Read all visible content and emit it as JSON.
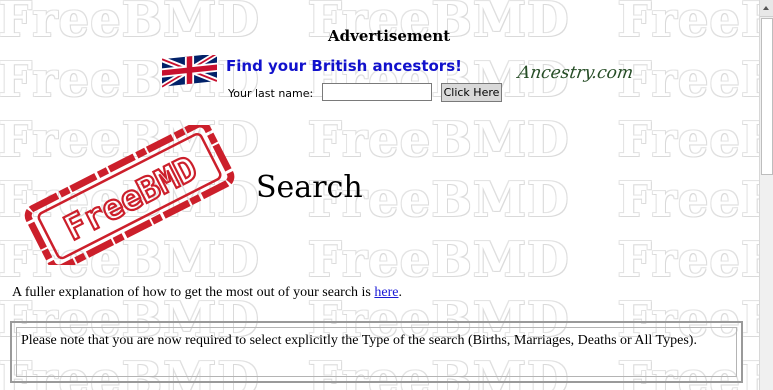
{
  "watermark": "FreeBMD",
  "ad": {
    "title": "Advertisement",
    "heading": "Find your British ancestors!",
    "lastname_label": "Your last name:",
    "lastname_value": "",
    "button_label": "Click Here",
    "brand": "Ancestry.com"
  },
  "logo": {
    "text": "FreeBMD"
  },
  "page_title": "Search",
  "explanation": {
    "text_before": "A fuller explanation of how to get the most out of your search is ",
    "link_text": "here",
    "text_after": "."
  },
  "notice": "Please note that you are now required to select explicitly the Type of the search (Births, Marriages, Deaths or All Types).",
  "colors": {
    "link": "#1a1ad6",
    "stamp": "#cc1f2b",
    "ad_heading": "#1111cc"
  }
}
